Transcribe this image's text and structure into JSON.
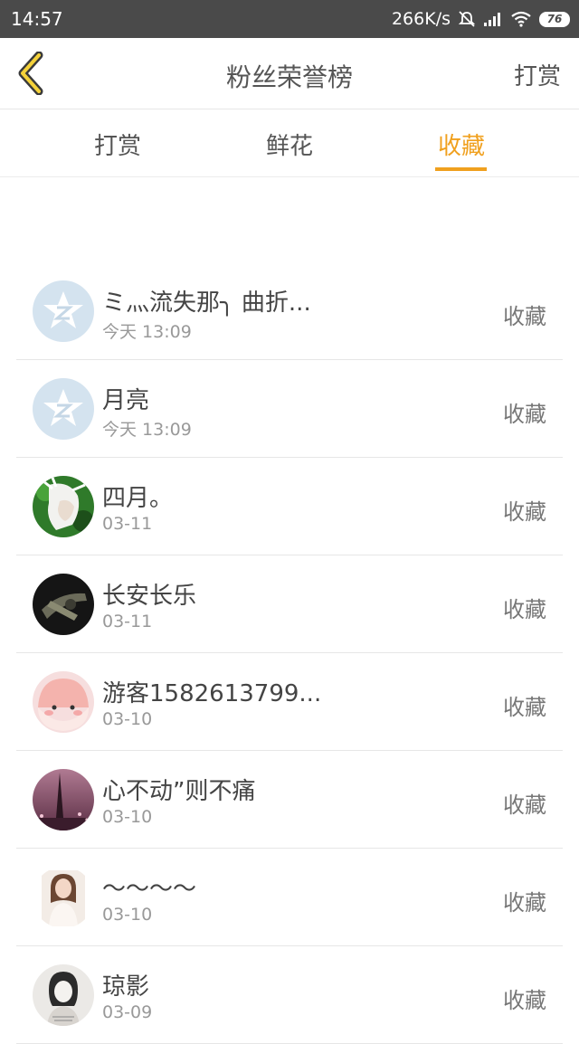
{
  "status_bar": {
    "time": "14:57",
    "speed": "266K/s",
    "battery": "76",
    "icons": [
      "mute-icon",
      "signal-icon",
      "wifi-icon",
      "battery-icon"
    ]
  },
  "header": {
    "title": "粉丝荣誉榜",
    "action": "打赏",
    "back_icon": "chevron-left-icon",
    "accent": "#f0a01e"
  },
  "tabs": [
    {
      "label": "打赏",
      "active": false
    },
    {
      "label": "鲜花",
      "active": false
    },
    {
      "label": "收藏",
      "active": true
    }
  ],
  "list": [
    {
      "name": "ミ灬流失那╮ 曲折...",
      "time": "今天 13:09",
      "action": "收藏",
      "avatar": "default-star-avatar"
    },
    {
      "name": "月亮",
      "time": "今天 13:09",
      "action": "收藏",
      "avatar": "default-star-avatar"
    },
    {
      "name": "四月。",
      "time": "03-11",
      "action": "收藏",
      "avatar": "anime-avatar"
    },
    {
      "name": "长安长乐",
      "time": "03-11",
      "action": "收藏",
      "avatar": "dark-photo-avatar"
    },
    {
      "name": "游客1582613799...",
      "time": "03-10",
      "action": "收藏",
      "avatar": "pink-cartoon-avatar"
    },
    {
      "name": "心不动”则不痛",
      "time": "03-10",
      "action": "收藏",
      "avatar": "tower-photo-avatar"
    },
    {
      "name": "～～～～",
      "time": "03-10",
      "action": "收藏",
      "avatar": "girl-photo-avatar"
    },
    {
      "name": "琼影",
      "time": "03-09",
      "action": "收藏",
      "avatar": "sketch-avatar"
    }
  ]
}
